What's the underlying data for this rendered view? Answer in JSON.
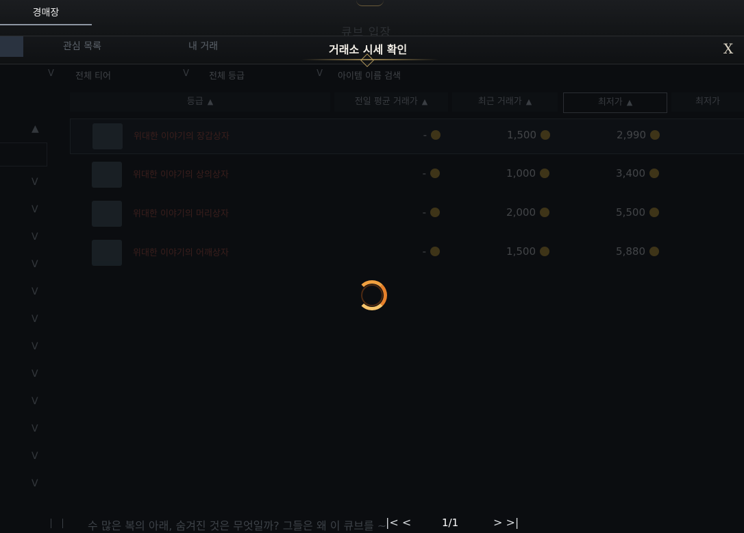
{
  "topbar": {
    "tab_label": "경매장",
    "faint_title": "큐브 입장"
  },
  "header": {
    "subtabs": [
      "관심 목록",
      "내 거래"
    ],
    "popup_title": "거래소 시세 확인",
    "close_label": "X"
  },
  "filters": {
    "tier": "전체 티어",
    "grade": "전체 등급",
    "search_placeholder": "아이템 이름 검색"
  },
  "table": {
    "columns": [
      "등급",
      "전일 평균 거래가",
      "최근 거래가",
      "최저가",
      "최저가"
    ],
    "rows": [
      {
        "name": "위대한 이야기의 장갑상자",
        "avg": "-",
        "recent": "1,500",
        "lowest": "2,990"
      },
      {
        "name": "위대한 이야기의 상의상자",
        "avg": "-",
        "recent": "1,000",
        "lowest": "3,400"
      },
      {
        "name": "위대한 이야기의 머리상자",
        "avg": "-",
        "recent": "2,000",
        "lowest": "5,500"
      },
      {
        "name": "위대한 이야기의 어깨상자",
        "avg": "-",
        "recent": "1,500",
        "lowest": "5,880"
      }
    ]
  },
  "sidebar": {
    "arrows": 14
  },
  "loading": {
    "state": "spinner"
  },
  "footer": {
    "text": "수 많은 복의 아래, 숨겨진 것은 무엇일까? 그들은 왜 이 큐브를 ~",
    "page": "1/1"
  },
  "colors": {
    "accent": "#c39a2f",
    "spinner": "#f0a040",
    "title": "#f0ece4"
  }
}
